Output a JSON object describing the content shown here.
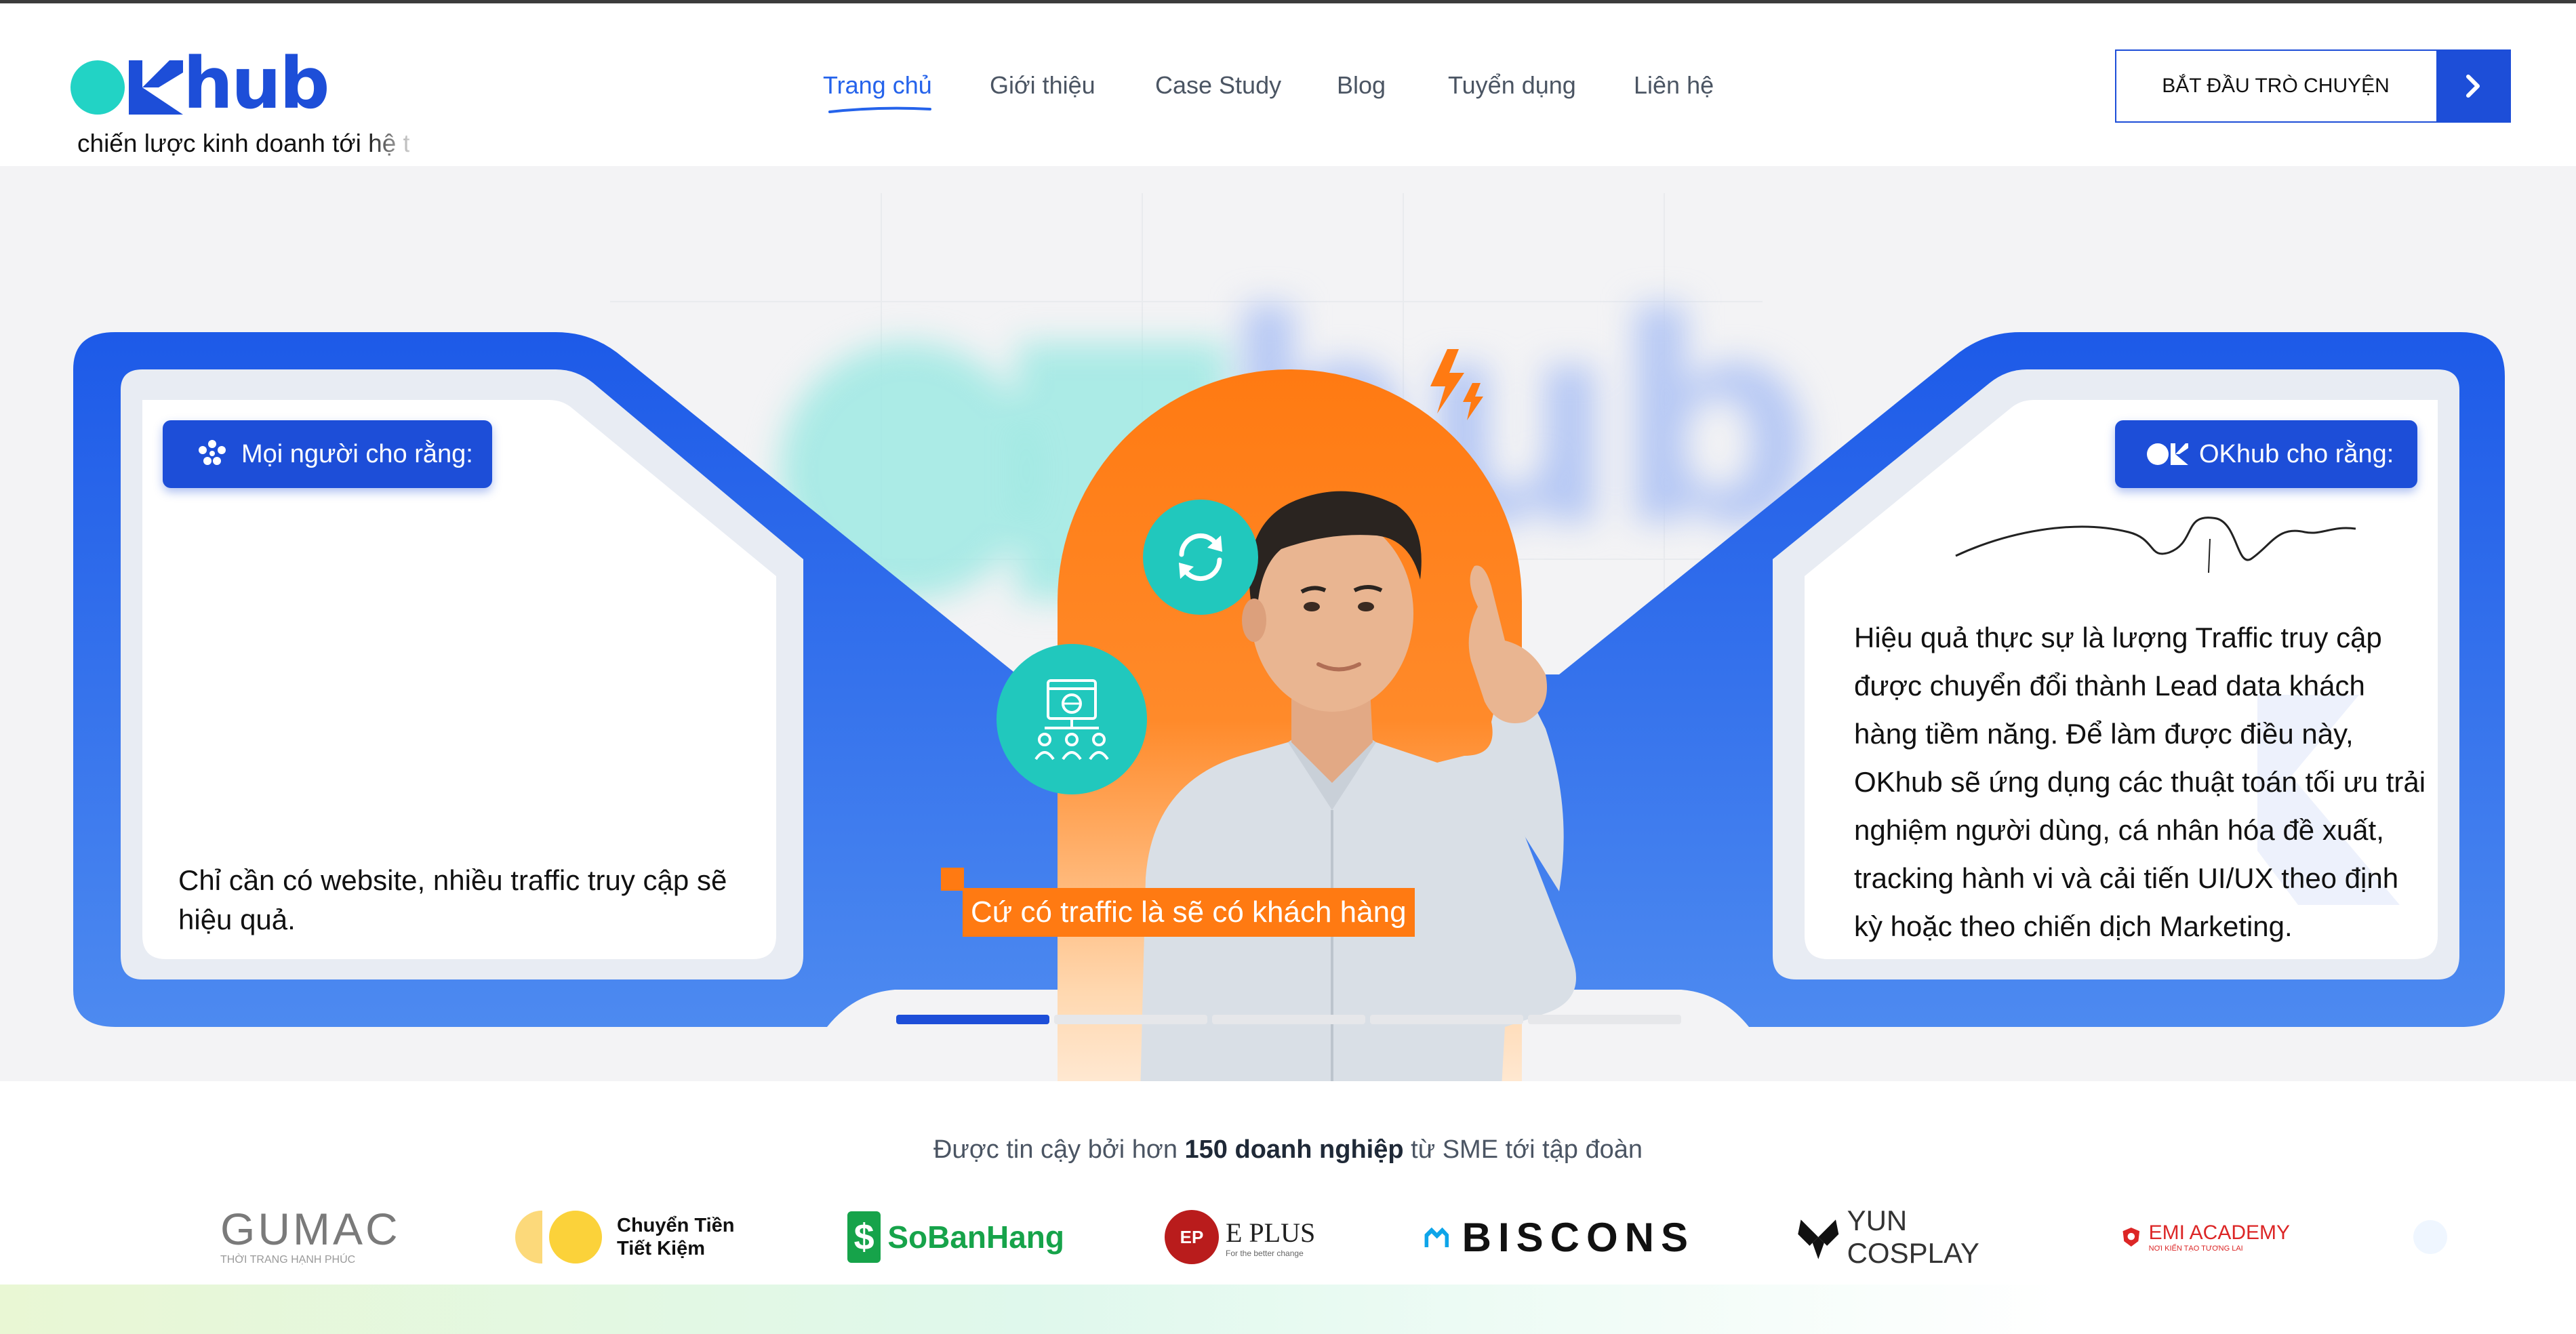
{
  "header": {
    "logo_text": "hub",
    "tagline": "chiến lược kinh doanh tới hệ t",
    "nav": [
      "Trang chủ",
      "Giới thiệu",
      "Case Study",
      "Blog",
      "Tuyển dụng",
      "Liên hệ"
    ],
    "active_nav": "Trang chủ",
    "cta_label": "BẮT ĐẦU TRÒ CHUYỆN"
  },
  "hero": {
    "left_pill": "Mọi người cho rằng:",
    "left_text": "Chỉ cần có website, nhiều traffic truy cập sẽ hiệu quả.",
    "right_pill": "OKhub cho rằng:",
    "right_text": "Hiệu quả thực sự là lượng Traffic truy cập được chuyển đổi thành Lead data khách hàng tiềm năng. Để làm được điều này, OKhub sẽ ứng dụng các thuật toán tối ưu trải nghiệm người dùng, cá nhân hóa đề xuất, tracking hành vi và cải tiến UI/UX theo định kỳ hoặc theo chiến dịch Marketing.",
    "caption": "Cứ có traffic là sẽ có khách hàng",
    "slide_count": 5,
    "active_slide": 1
  },
  "trust": {
    "prefix": "Được tin cậy bởi hơn ",
    "highlight": "150 doanh nghiệp",
    "suffix": " từ SME tới tập đoàn",
    "brands": [
      {
        "name": "GUMAC",
        "sub": "THỜI TRANG HẠNH PHÚC"
      },
      {
        "name": "Chuyển Tiền",
        "sub": "Tiết Kiệm"
      },
      {
        "name": "SoBanHang"
      },
      {
        "name": "E PLUS",
        "sub": "For the better change"
      },
      {
        "name": "BISCONS"
      },
      {
        "name": "YUN COSPLAY"
      },
      {
        "name": "EMI ACADEMY",
        "sub": "NƠI KIẾN TẠO TƯƠNG LAI"
      }
    ]
  },
  "colors": {
    "primary": "#1d4ed8",
    "teal": "#22d3c5",
    "orange": "#ff7a12"
  }
}
